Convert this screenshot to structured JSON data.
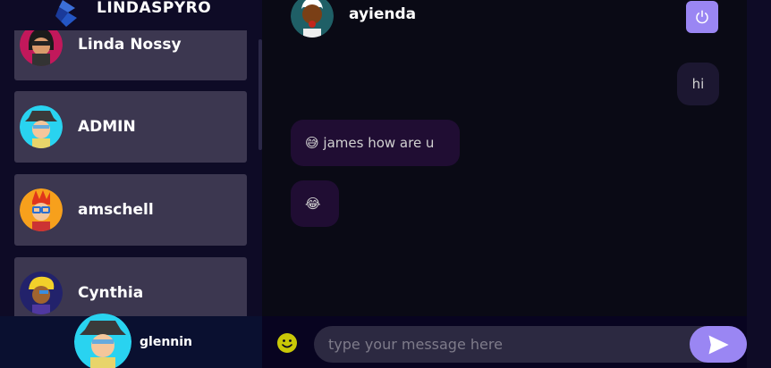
{
  "brand": {
    "title": "LINDASPYRO"
  },
  "contacts": [
    {
      "name": "Linda Nossy"
    },
    {
      "name": "ADMIN"
    },
    {
      "name": "amschell"
    },
    {
      "name": "Cynthia"
    }
  ],
  "current_user": {
    "name": "glennin"
  },
  "chat": {
    "contact_name": "ayienda"
  },
  "messages": [
    {
      "direction": "sent",
      "text": "hi"
    },
    {
      "direction": "received",
      "text": "😅 james how are u"
    },
    {
      "direction": "received",
      "text": "😂"
    }
  ],
  "composer": {
    "placeholder": "type your message here",
    "value": ""
  },
  "colors": {
    "accent": "#9a86f3",
    "sidebar_bg": "#0e0b26",
    "contact_card": "#3c3750",
    "chat_bg": "#0a0a15"
  },
  "icons": {
    "logout": "power-icon",
    "emoji": "smiley-icon",
    "send": "send-icon"
  }
}
